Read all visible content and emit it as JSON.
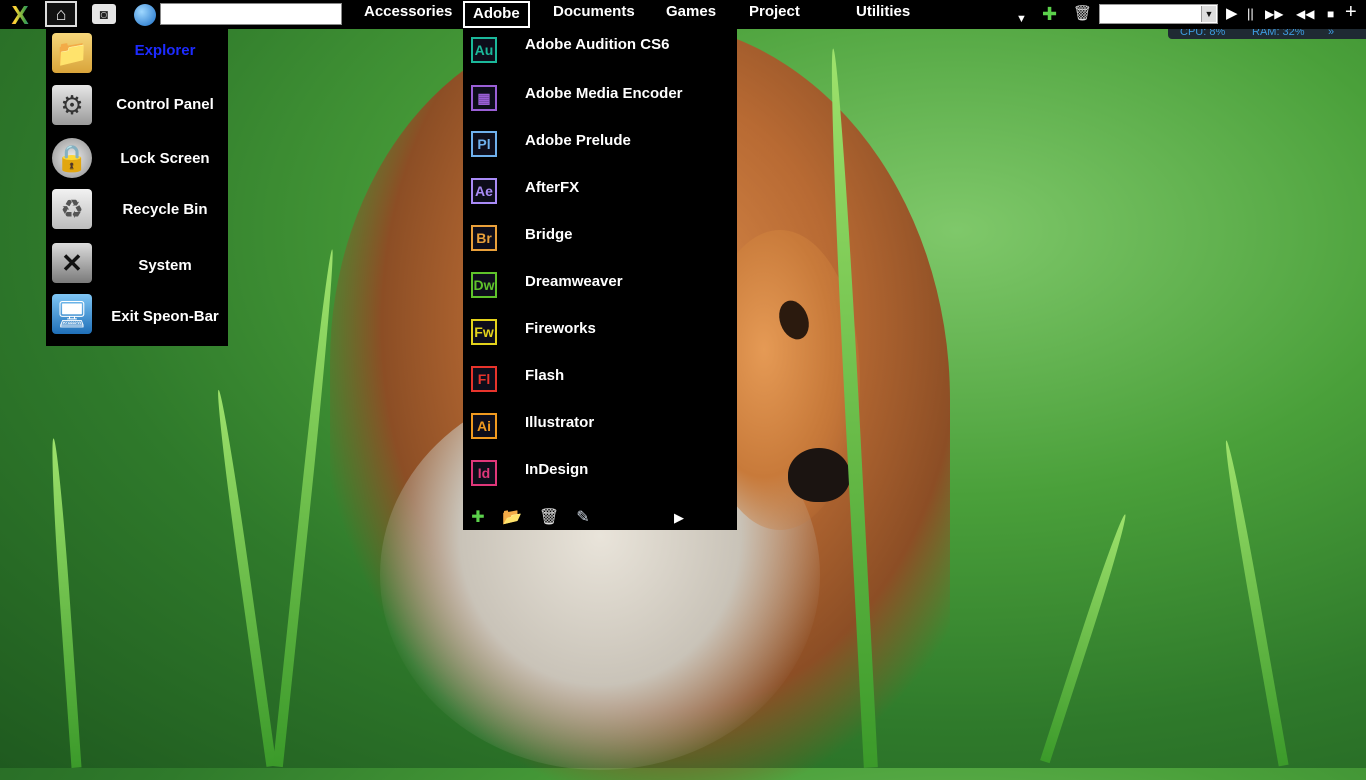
{
  "taskbar": {
    "logo_glyph": "X",
    "home_glyph": "⌂",
    "camera_glyph": "◙",
    "search_value": "",
    "menus": [
      {
        "label": "Accessories",
        "active": false
      },
      {
        "label": "Adobe",
        "active": true
      },
      {
        "label": "Documents",
        "active": false
      },
      {
        "label": "Games",
        "active": false
      },
      {
        "label": "Project",
        "active": false
      },
      {
        "label": "Utilities",
        "active": false
      }
    ],
    "overflow_glyph": "▼",
    "add_glyph": "✚",
    "trash_glyph": "🗑",
    "dropdown_value": "",
    "dropdown_arrow": "▼",
    "media": {
      "play": "▶",
      "pause": "||",
      "forward": "▶▶",
      "rewind": "◀◀",
      "stop": "■",
      "add": "+"
    },
    "stats": {
      "cpu": "CPU: 8%",
      "ram": "RAM: 32%",
      "pin": "»"
    }
  },
  "start_menu": {
    "items": [
      {
        "label": "Explorer",
        "icon": "folder-icon",
        "glyph": "📁",
        "highlight": true
      },
      {
        "label": "Control Panel",
        "icon": "control-panel-icon",
        "glyph": "⚙",
        "highlight": false
      },
      {
        "label": "Lock Screen",
        "icon": "lock-icon",
        "glyph": "🔒",
        "highlight": false
      },
      {
        "label": "Recycle Bin",
        "icon": "recycle-bin-icon",
        "glyph": "♻",
        "highlight": false
      },
      {
        "label": "System",
        "icon": "system-icon",
        "glyph": "✕",
        "highlight": false
      },
      {
        "label": "Exit Speon-Bar",
        "icon": "exit-icon",
        "glyph": "🖥",
        "highlight": false
      }
    ]
  },
  "adobe_menu": {
    "items": [
      {
        "label": "Adobe Audition CS6",
        "abbr": "Au",
        "color": "#1bb89a"
      },
      {
        "label": "Adobe Media Encoder",
        "abbr": "▦",
        "color": "#9a5fd6"
      },
      {
        "label": "Adobe Prelude",
        "abbr": "Pl",
        "color": "#6fb0ec"
      },
      {
        "label": "AfterFX",
        "abbr": "Ae",
        "color": "#a98bf7"
      },
      {
        "label": "Bridge",
        "abbr": "Br",
        "color": "#e9a03a"
      },
      {
        "label": "Dreamweaver",
        "abbr": "Dw",
        "color": "#5fc22b"
      },
      {
        "label": "Fireworks",
        "abbr": "Fw",
        "color": "#e3d21b"
      },
      {
        "label": "Flash",
        "abbr": "Fl",
        "color": "#e8342c"
      },
      {
        "label": "Illustrator",
        "abbr": "Ai",
        "color": "#f09a1f"
      },
      {
        "label": "InDesign",
        "abbr": "Id",
        "color": "#e0377a"
      }
    ],
    "footer": {
      "add_glyph": "✚",
      "folder_glyph": "📂",
      "trash_glyph": "🗑",
      "edit_glyph": "✎",
      "more_glyph": "▶"
    }
  }
}
